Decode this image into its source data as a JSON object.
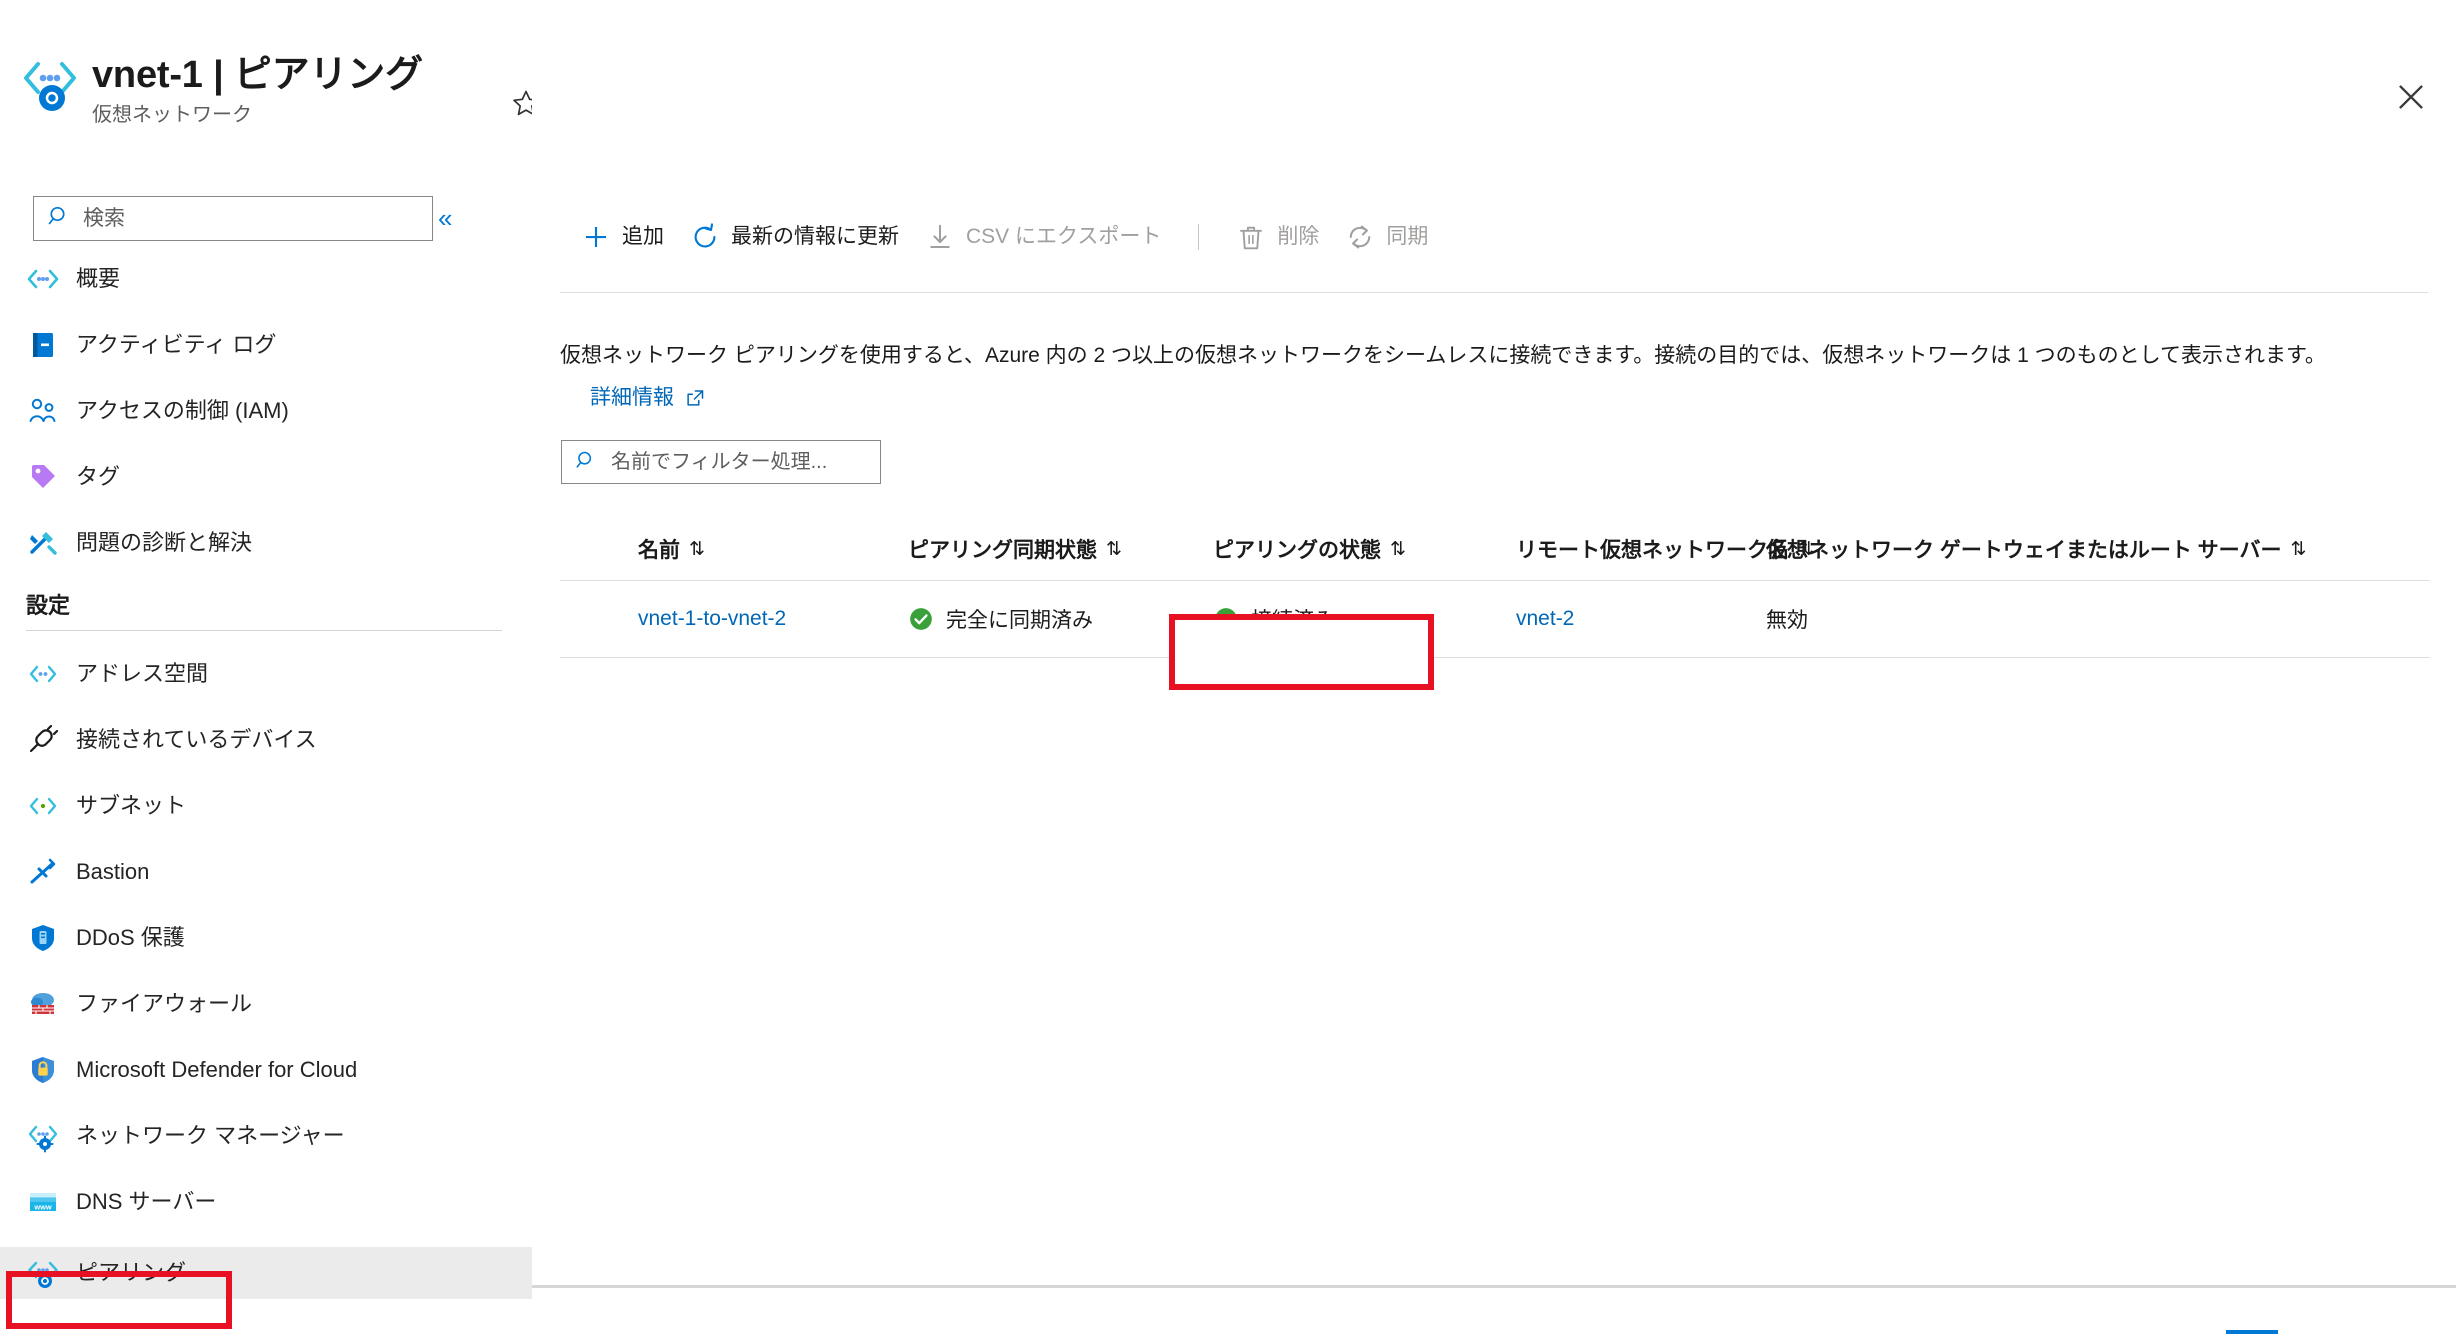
{
  "header": {
    "resource_name": "vnet-1",
    "title": "vnet-1 | ピアリング",
    "subtitle": "仮想ネットワーク",
    "favorite_icon": "star-icon",
    "more_label": "···",
    "close_icon": "close-icon"
  },
  "sidebar": {
    "search": {
      "placeholder": "検索",
      "value": "",
      "icon": "search-icon"
    },
    "collapse_label": "«",
    "items": [
      {
        "label": "概要",
        "icon": "vnet-icon",
        "selected": false
      },
      {
        "label": "アクティビティ ログ",
        "icon": "activity-log-icon",
        "selected": false
      },
      {
        "label": "アクセスの制御 (IAM)",
        "icon": "access-control-icon",
        "selected": false
      },
      {
        "label": "タグ",
        "icon": "tag-icon",
        "selected": false
      },
      {
        "label": "問題の診断と解決",
        "icon": "troubleshoot-icon",
        "selected": false
      }
    ],
    "settings_section": {
      "title": "設定",
      "items": [
        {
          "label": "アドレス空間",
          "icon": "address-space-icon",
          "selected": false
        },
        {
          "label": "接続されているデバイス",
          "icon": "connected-devices-icon",
          "selected": false
        },
        {
          "label": "サブネット",
          "icon": "subnet-icon",
          "selected": false
        },
        {
          "label": "Bastion",
          "icon": "bastion-icon",
          "selected": false
        },
        {
          "label": "DDoS 保護",
          "icon": "ddos-shield-icon",
          "selected": false
        },
        {
          "label": "ファイアウォール",
          "icon": "firewall-icon",
          "selected": false
        },
        {
          "label": "Microsoft Defender for Cloud",
          "icon": "defender-shield-icon",
          "selected": false
        },
        {
          "label": "ネットワーク マネージャー",
          "icon": "network-manager-icon",
          "selected": false
        },
        {
          "label": "DNS サーバー",
          "icon": "dns-server-icon",
          "selected": false
        },
        {
          "label": "ピアリング",
          "icon": "peering-icon",
          "selected": true
        }
      ]
    }
  },
  "toolbar": {
    "add_label": "追加",
    "refresh_label": "最新の情報に更新",
    "export_csv_label": "CSV にエクスポート",
    "delete_label": "削除",
    "sync_label": "同期",
    "add_icon": "plus-icon",
    "refresh_icon": "refresh-icon",
    "export_icon": "download-icon",
    "delete_icon": "trash-icon",
    "sync_icon": "sync-icon"
  },
  "description": {
    "text": "仮想ネットワーク ピアリングを使用すると、Azure 内の 2 つ以上の仮想ネットワークをシームレスに接続できます。接続の目的では、仮想ネットワークは 1 つのものとして表示されます。",
    "learn_more_label": "詳細情報",
    "learn_more_icon": "external-link-icon"
  },
  "filter": {
    "placeholder": "名前でフィルター処理...",
    "value": "",
    "icon": "search-icon"
  },
  "table": {
    "sort_icon": "sort-arrows-icon",
    "columns": [
      {
        "label": "名前"
      },
      {
        "label": "ピアリング同期状態"
      },
      {
        "label": "ピアリングの状態"
      },
      {
        "label": "リモート仮想ネットワーク名"
      },
      {
        "label": "仮想ネットワーク ゲートウェイまたはルート サーバー"
      }
    ],
    "rows": [
      {
        "name": "vnet-1-to-vnet-2",
        "sync_state": "完全に同期済み",
        "sync_state_icon": "check-circle-icon",
        "peering_state": "接続済み",
        "peering_state_icon": "check-circle-icon",
        "remote_vnet": "vnet-2",
        "gateway": "無効"
      }
    ]
  },
  "colors": {
    "accent": "#0078d4",
    "link": "#0067b8",
    "success": "#3aa03a",
    "highlight_box": "#e81123",
    "selected_bg": "#ebebeb"
  }
}
